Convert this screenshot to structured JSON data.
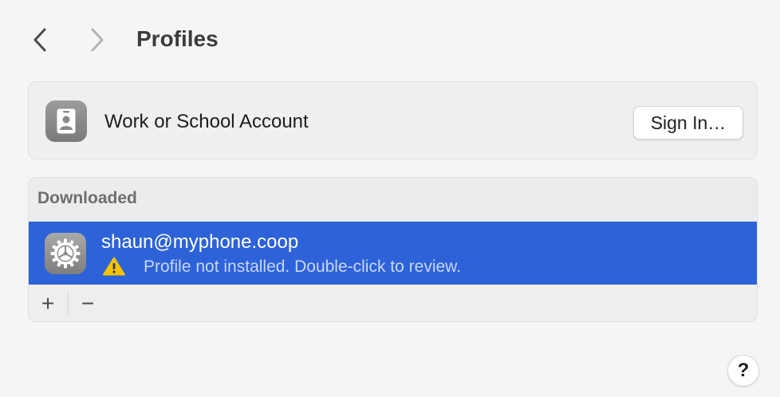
{
  "header": {
    "title": "Profiles",
    "back_icon": "chevron-left-icon",
    "forward_icon": "chevron-right-icon"
  },
  "account": {
    "icon": "id-badge-icon",
    "label": "Work or School Account",
    "sign_in_label": "Sign In…"
  },
  "downloaded": {
    "header": "Downloaded",
    "items": [
      {
        "icon": "gear-icon",
        "name": "shaun@myphone.coop",
        "status_icon": "warning-icon",
        "status": "Profile not installed. Double-click to review.",
        "selected": true
      }
    ],
    "add_label": "+",
    "remove_label": "−"
  },
  "help": {
    "label": "?"
  },
  "colors": {
    "selection": "#2d62d8",
    "warning": "#f5c400",
    "background": "#f5f5f5"
  }
}
